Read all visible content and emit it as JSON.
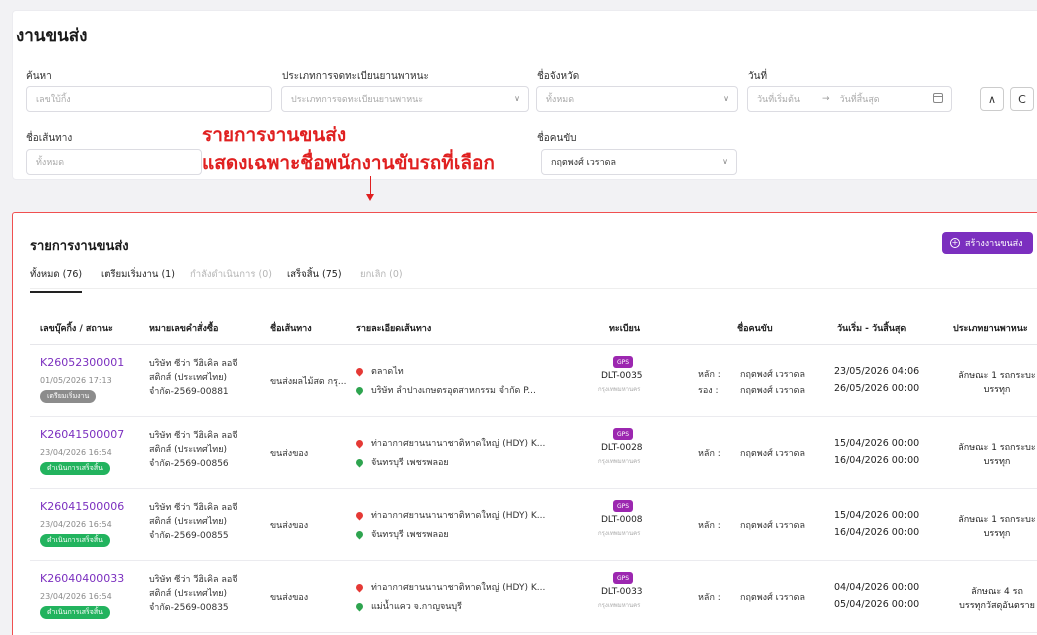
{
  "page_title": "งานขนส่ง",
  "filters": {
    "search": {
      "label": "ค้นหา",
      "placeholder": "เลขใบ้กิ้ง"
    },
    "vehicle_reg_type": {
      "label": "ประเภทการจดทะเบียนยานพาหนะ",
      "placeholder": "ประเภทการจดทะเบียนยานพาหนะ"
    },
    "province": {
      "label": "ชื่อจังหวัด",
      "value": "ทั้งหมด"
    },
    "date": {
      "label": "วันที่",
      "start_placeholder": "วันที่เริ่มต้น",
      "end_placeholder": "วันที่สิ้นสุด",
      "arrow": "→"
    },
    "route": {
      "label": "ชื่อเส้นทาง",
      "value": "ทั้งหมด"
    },
    "driver": {
      "label": "ชื่อคนขับ",
      "value": "กฤตพงศ์ เวราดล"
    },
    "collapse_btn": "∧",
    "refresh_btn": "C"
  },
  "annotation": {
    "line1": "รายการงานขนส่ง",
    "line2": "แสดงเฉพาะชื่อพนักงานขับรถที่เลือก"
  },
  "list": {
    "title": "รายการงานขนส่ง",
    "create_button": "สร้างงานขนส่ง",
    "tabs": [
      {
        "label": "ทั้งหมด (76)",
        "state": "active"
      },
      {
        "label": "เตรียมเริ่มงาน (1)",
        "state": "normal"
      },
      {
        "label": "กำลังดำเนินการ (0)",
        "state": "disabled"
      },
      {
        "label": "เสร็จสิ้น (75)",
        "state": "normal"
      },
      {
        "label": "ยกเลิก (0)",
        "state": "disabled"
      }
    ],
    "headers": [
      "เลขบุ๊คกิ้ง / สถานะ",
      "หมายเลขคำสั่งซื้อ",
      "ชื่อเส้นทาง",
      "รายละเอียดเส้นทาง",
      "ทะเบียน",
      "ชื่อคนขับ",
      "วันเริ่ม - วันสิ้นสุด",
      "ประเภทยานพาหนะ"
    ],
    "driver_main_label": "หลัก :",
    "driver_backup_label": "รอง :",
    "rows": [
      {
        "booking": "K26052300001",
        "date": "01/05/2026 17:13",
        "status": "เตรียมเริ่มงาน",
        "status_color": "#8c8c8c",
        "order": [
          "บริษัท ซีว่า วีฮิเคิล ลอจี",
          "สติกส์ (ประเทศไทย)",
          "จำกัด-2569-00881"
        ],
        "route_name": "ขนส่งผลไม้สด กรุ...",
        "origin": "ตลาดไท",
        "destination": "บริษัท ลำปางเกษตรอุตสาหกรรม จำกัด P...",
        "gps": "GPS",
        "plate": "DLT-0035",
        "province": "กรุงเทพมหานคร",
        "driver_main": "กฤตพงศ์ เวราดล",
        "driver_backup": "กฤตพงศ์ เวราดล",
        "start": "23/05/2026 04:06",
        "end": "26/05/2026 00:00",
        "vehicle_type": [
          "ลักษณะ 1 รถกระบะ",
          "บรรทุก"
        ]
      },
      {
        "booking": "K26041500007",
        "date": "23/04/2026 16:54",
        "status": "ดำเนินการเสร็จสิ้น",
        "status_color": "#22b35e",
        "order": [
          "บริษัท ซีว่า วีฮิเคิล ลอจี",
          "สติกส์ (ประเทศไทย)",
          "จำกัด-2569-00856"
        ],
        "route_name": "ขนส่งของ",
        "origin": "ท่าอากาศยานนานาชาติหาดใหญ่ (HDY) K...",
        "destination": "จันทรบุรี เพชรพลอย",
        "gps": "GPS",
        "plate": "DLT-0028",
        "province": "กรุงเทพมหานคร",
        "driver_main": "กฤตพงศ์ เวราดล",
        "driver_backup": "",
        "start": "15/04/2026 00:00",
        "end": "16/04/2026 00:00",
        "vehicle_type": [
          "ลักษณะ 1 รถกระบะ",
          "บรรทุก"
        ]
      },
      {
        "booking": "K26041500006",
        "date": "23/04/2026 16:54",
        "status": "ดำเนินการเสร็จสิ้น",
        "status_color": "#22b35e",
        "order": [
          "บริษัท ซีว่า วีฮิเคิล ลอจี",
          "สติกส์ (ประเทศไทย)",
          "จำกัด-2569-00855"
        ],
        "route_name": "ขนส่งของ",
        "origin": "ท่าอากาศยานนานาชาติหาดใหญ่ (HDY) K...",
        "destination": "จันทรบุรี เพชรพลอย",
        "gps": "GPS",
        "plate": "DLT-0008",
        "province": "กรุงเทพมหานคร",
        "driver_main": "กฤตพงศ์ เวราดล",
        "driver_backup": "",
        "start": "15/04/2026 00:00",
        "end": "16/04/2026 00:00",
        "vehicle_type": [
          "ลักษณะ 1 รถกระบะ",
          "บรรทุก"
        ]
      },
      {
        "booking": "K26040400033",
        "date": "23/04/2026 16:54",
        "status": "ดำเนินการเสร็จสิ้น",
        "status_color": "#22b35e",
        "order": [
          "บริษัท ซีว่า วีฮิเคิล ลอจี",
          "สติกส์ (ประเทศไทย)",
          "จำกัด-2569-00835"
        ],
        "route_name": "ขนส่งของ",
        "origin": "ท่าอากาศยานนานาชาติหาดใหญ่ (HDY) K...",
        "destination": "แม่น้ำแคว จ.กาญจนบุรี",
        "gps": "GPS",
        "plate": "DLT-0033",
        "province": "กรุงเทพมหานคร",
        "driver_main": "กฤตพงศ์ เวราดล",
        "driver_backup": "",
        "start": "04/04/2026 00:00",
        "end": "05/04/2026 00:00",
        "vehicle_type": [
          "ลักษณะ 4 รถ",
          "บรรทุกวัสดุอันตราย"
        ]
      }
    ]
  }
}
